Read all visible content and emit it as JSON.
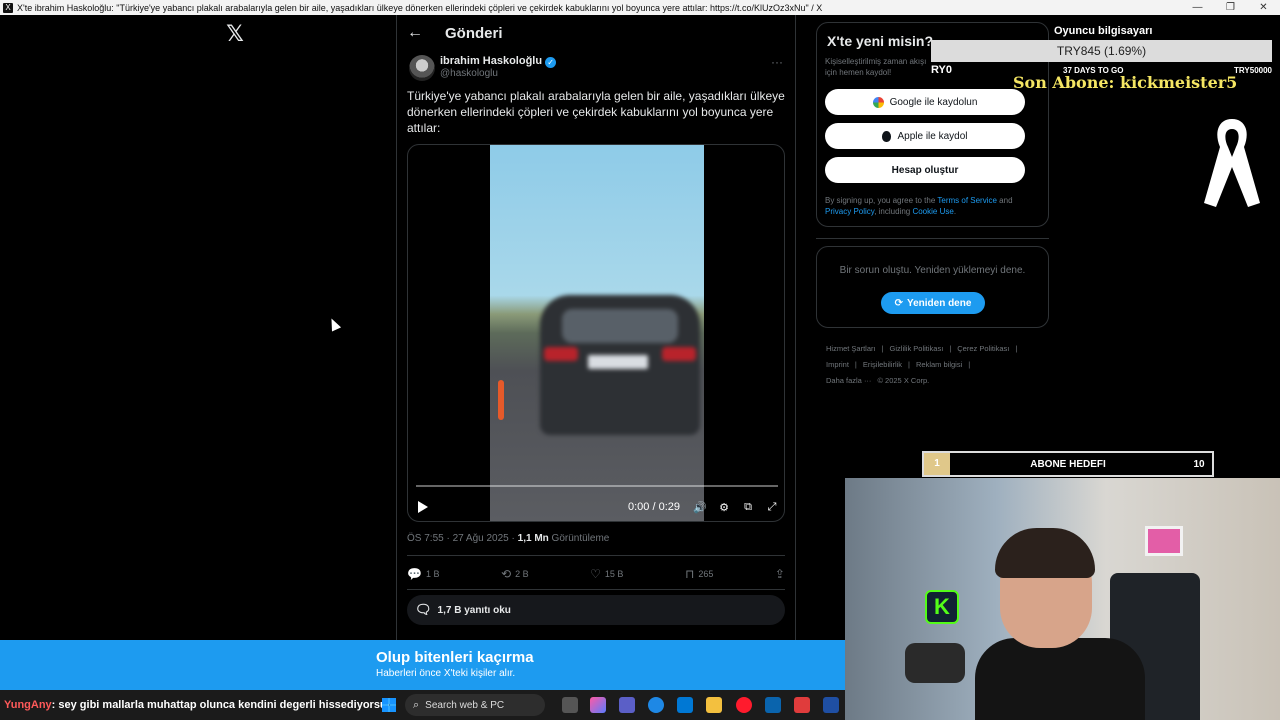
{
  "window": {
    "title": "X'te ibrahim Haskoloğlu: \"Türkiye'ye yabancı plakalı arabalarıyla gelen bir aile, yaşadıkları ülkeye dönerken ellerindeki çöpleri ve çekirdek kabuklarını yol boyunca yere attılar: https://t.co/KlUzOz3xNu\" / X",
    "minimize": "—",
    "maximize": "❐",
    "close": "✕"
  },
  "x_logo": "𝕏",
  "post": {
    "header_title": "Gönderi",
    "author_name": "ibrahim Haskoloğlu",
    "author_handle": "@haskologlu",
    "text": "Türkiye'ye yabancı plakalı arabalarıyla gelen bir aile, yaşadıkları ülkeye dönerken ellerindeki çöpleri ve çekirdek kabuklarını yol boyunca yere attılar:",
    "video_time": "0:00 / 0:29",
    "video_progress": 0,
    "timestamp": "ÖS 7:55 · 27 Ağu 2025 · ",
    "views_count": "1,1 Mn",
    "views_label": " Görüntüleme",
    "replies": "1 B",
    "reposts": "2 B",
    "likes": "15 B",
    "bookmarks": "265",
    "read_replies": "1,7 B yanıtı oku"
  },
  "signup": {
    "title": "X'te yeni misin?",
    "subtitle": "Kişiselleştirilmiş zaman akışı için hemen kaydol!",
    "google": "Google ile kaydolun",
    "apple": "Apple ile kaydol",
    "create": "Hesap oluştur",
    "terms_prefix": "By signing up, you agree to the ",
    "terms_tos": "Terms of Service",
    "terms_and": " and ",
    "terms_privacy": "Privacy Policy",
    "terms_including": ", including ",
    "terms_cookie": "Cookie Use",
    "terms_end": "."
  },
  "error": {
    "message": "Bir sorun oluştu. Yeniden yüklemeyi dene.",
    "retry": "Yeniden dene"
  },
  "footer": {
    "links": [
      "Hizmet Şartları",
      "|",
      "Gizlilik Politikası",
      "|",
      "Çerez Politikası",
      "|",
      "Imprint",
      "|",
      "Erişilebilirlik",
      "|",
      "Reklam bilgisi",
      "|",
      "Daha fazla ···",
      "© 2025 X Corp."
    ]
  },
  "overlay": {
    "goal_title": "Oyuncu bilgisayarı",
    "donation_amount": "TRY845 (1.69%)",
    "donation_progress": 0.0169,
    "bar_left": "RY0",
    "bar_center": "37 DAYS TO GO",
    "bar_right": "TRY50000",
    "last_sub": "Son Abone: kickmeister5",
    "sub_goal_current": "1",
    "sub_goal_label": "ABONE HEDEFI",
    "sub_goal_target": "10",
    "kick_letter": "K"
  },
  "banner": {
    "headline": "Olup bitenleri kaçırma",
    "sub": "Haberleri önce X'teki kişiler alır."
  },
  "chat": {
    "user": "YungAny",
    "message": ": sey gibi mallarla muhattap olunca kendini degerli hissediyorsun"
  },
  "taskbar": {
    "search_placeholder": "Search web & PC"
  }
}
